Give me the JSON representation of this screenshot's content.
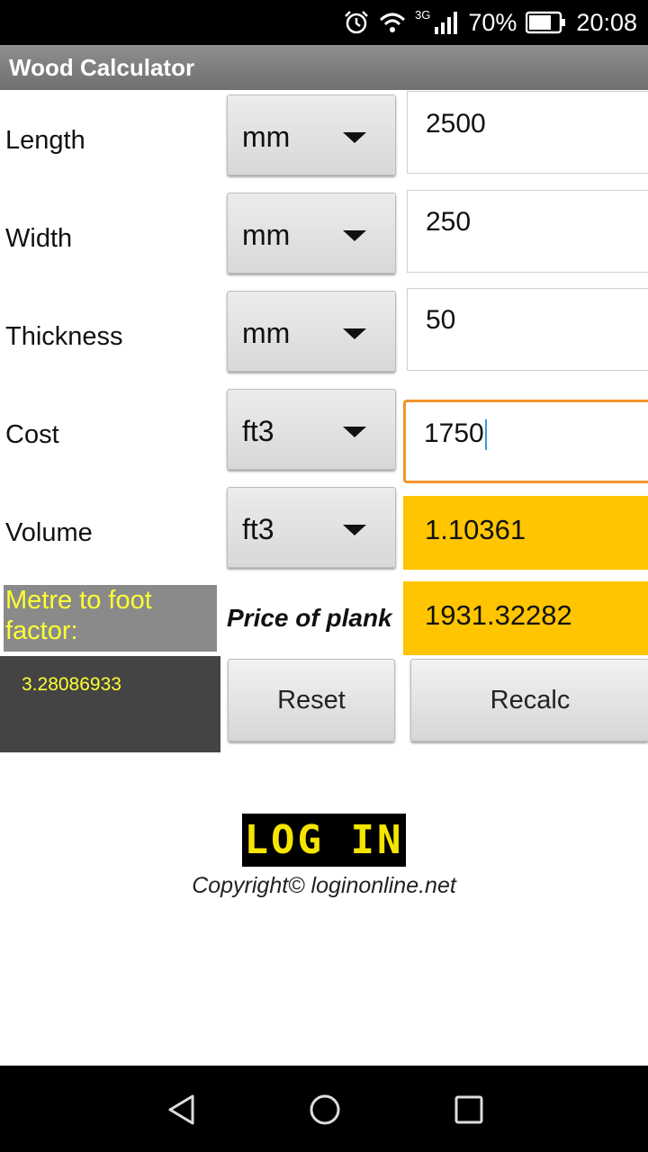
{
  "status_bar": {
    "network": "3G",
    "battery": "70%",
    "time": "20:08",
    "icons": [
      "alarm-icon",
      "wifi-icon",
      "signal-icon",
      "battery-icon"
    ]
  },
  "app": {
    "title": "Wood Calculator"
  },
  "rows": [
    {
      "label": "Length",
      "unit": "mm",
      "value": "2500"
    },
    {
      "label": "Width",
      "unit": "mm",
      "value": "250"
    },
    {
      "label": "Thickness",
      "unit": "mm",
      "value": "50"
    },
    {
      "label": "Cost",
      "unit": "ft3",
      "value": "1750"
    },
    {
      "label": "Volume",
      "unit": "ft3",
      "value": "1.10361"
    }
  ],
  "factor": {
    "label": "Metre to foot factor:",
    "value": "3.28086933"
  },
  "price": {
    "label": "Price of plank",
    "value": "1931.32282"
  },
  "buttons": {
    "reset": "Reset",
    "recalc": "Recalc"
  },
  "logo": {
    "text": "LOG IN"
  },
  "copyright": "Copyright© loginonline.net",
  "colors": {
    "accent": "#ffc500",
    "focus": "#f0952a",
    "factor_text": "#ffff33",
    "logo_text": "#f5e600"
  },
  "nav": [
    "back-icon",
    "home-icon",
    "recents-icon"
  ]
}
